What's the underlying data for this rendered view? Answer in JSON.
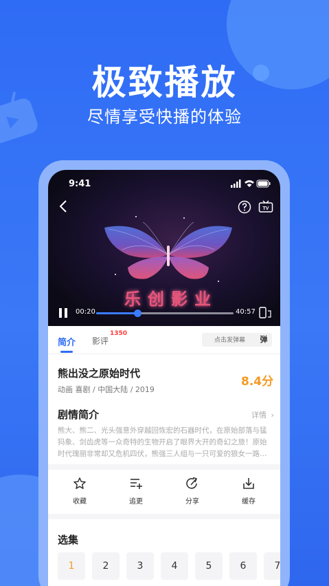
{
  "hero": {
    "headline": "极致播放",
    "subline": "尽情享受快播的体验"
  },
  "status_bar": {
    "time": "9:41"
  },
  "player": {
    "watermark": "乐创影业",
    "current_time": "00:20",
    "total_time": "40:57",
    "progress": 0.3
  },
  "tabs": {
    "intro": "简介",
    "review": "影评",
    "review_count": "1350",
    "danmaku_placeholder": "点击发弹幕",
    "danmaku_button": "弹"
  },
  "show": {
    "title": "熊出没之原始时代",
    "meta": "动画 喜剧 / 中国大陆 / 2019",
    "score": "8.4分"
  },
  "plot": {
    "heading": "剧情简介",
    "more": "详情",
    "text": "熊大、熊二、光头强意外穿越回恢宏的石器时代，在原始部落与猛犸象、剑齿虎等一众奇特的生物开启了眼界大开的奇幻之旅！原始时代瑰丽非常却又危机四伏，熊强三人组与一只可爱的狼女一路…"
  },
  "actions": {
    "favorite": "收藏",
    "follow": "追更",
    "share": "分享",
    "download": "缓存"
  },
  "episodes": {
    "heading": "选集",
    "items": [
      "1",
      "2",
      "3",
      "4",
      "5",
      "6",
      "7"
    ]
  },
  "colors": {
    "brand_blue": "#2f6cf5",
    "score_orange": "#f59a23",
    "badge_red": "#ff3b3b"
  }
}
